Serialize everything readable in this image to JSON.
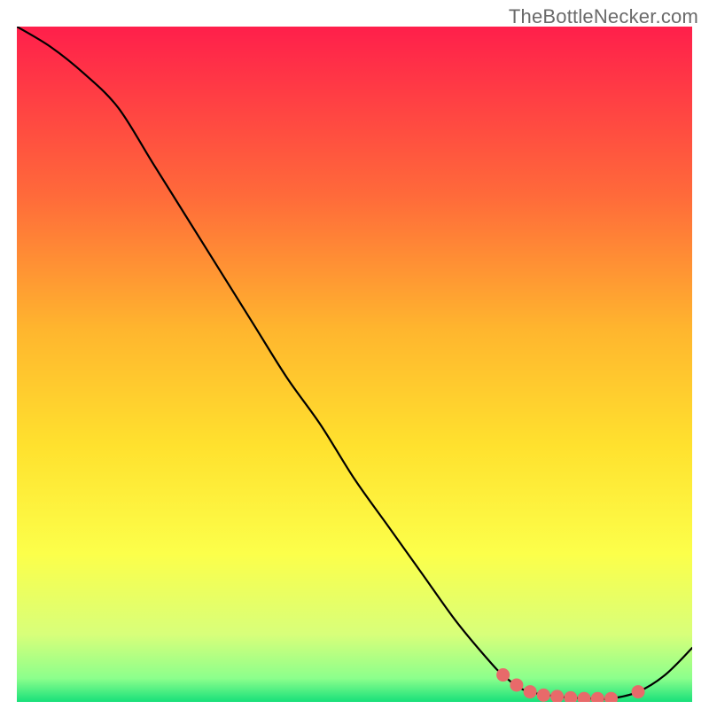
{
  "watermark": "TheBottleNecker.com",
  "chart_data": {
    "type": "line",
    "title": "",
    "xlabel": "",
    "ylabel": "",
    "xlim": [
      0,
      100
    ],
    "ylim": [
      0,
      100
    ],
    "series": [
      {
        "name": "curve",
        "x": [
          0,
          5,
          10,
          15,
          20,
          25,
          30,
          35,
          40,
          45,
          50,
          55,
          60,
          65,
          70,
          72,
          75,
          80,
          85,
          88,
          92,
          96,
          100
        ],
        "y": [
          100,
          97,
          93,
          88,
          80,
          72,
          64,
          56,
          48,
          41,
          33,
          26,
          19,
          12,
          6,
          4,
          1.8,
          0.8,
          0.5,
          0.5,
          1.5,
          4,
          8
        ]
      }
    ],
    "markers": {
      "name": "bottleneck-region",
      "color": "#e86a6a",
      "x": [
        72,
        74,
        76,
        78,
        80,
        82,
        84,
        86,
        88,
        92
      ],
      "y": [
        4,
        2.5,
        1.5,
        1.0,
        0.8,
        0.6,
        0.5,
        0.5,
        0.5,
        1.5
      ]
    },
    "gradient_stops": [
      {
        "offset": 0,
        "color": "#ff1f4b"
      },
      {
        "offset": 0.25,
        "color": "#ff6a3a"
      },
      {
        "offset": 0.45,
        "color": "#ffb62e"
      },
      {
        "offset": 0.62,
        "color": "#ffe12e"
      },
      {
        "offset": 0.78,
        "color": "#fcff4a"
      },
      {
        "offset": 0.9,
        "color": "#d8ff7a"
      },
      {
        "offset": 0.965,
        "color": "#8cff8c"
      },
      {
        "offset": 1.0,
        "color": "#18e07a"
      }
    ]
  }
}
